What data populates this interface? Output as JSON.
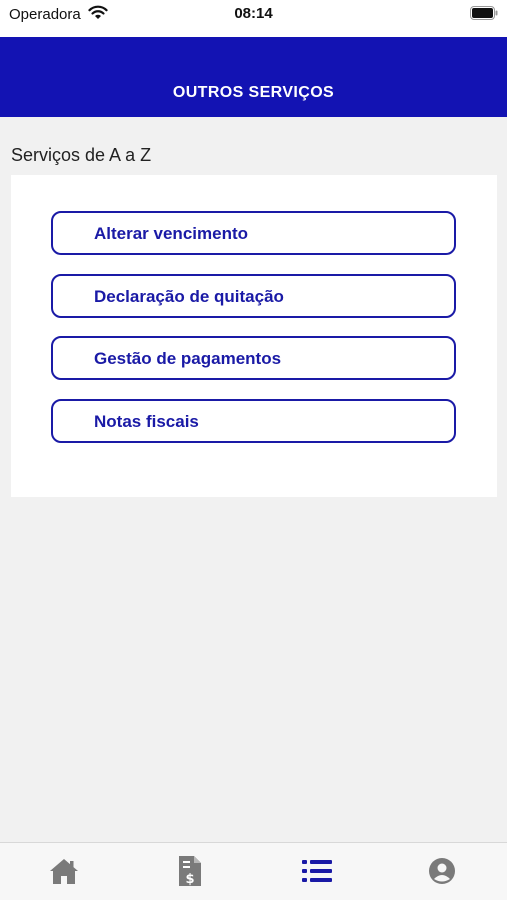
{
  "status_bar": {
    "carrier": "Operadora",
    "time": "08:14"
  },
  "header": {
    "title": "OUTROS SERVIÇOS"
  },
  "section": {
    "title": "Serviços de A a Z"
  },
  "services": [
    {
      "label": "Alterar vencimento"
    },
    {
      "label": "Declaração de quitação"
    },
    {
      "label": "Gestão de pagamentos"
    },
    {
      "label": "Notas fiscais"
    }
  ],
  "tab_bar": {
    "items": [
      {
        "icon": "home-icon",
        "active": false
      },
      {
        "icon": "invoice-icon",
        "active": false
      },
      {
        "icon": "list-icon",
        "active": true
      },
      {
        "icon": "profile-icon",
        "active": false
      }
    ]
  },
  "colors": {
    "primary": "#1313b3",
    "active_tab": "#1a1aa6",
    "inactive_tab": "#7a7a7a"
  }
}
